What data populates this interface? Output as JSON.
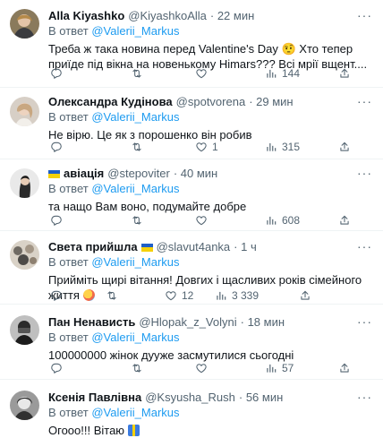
{
  "reply_prefix": "В ответ",
  "mention": "@Valerii_Markus",
  "tweets": [
    {
      "name": "Alla Kiyashko",
      "handle": "@KiyashkoAlla",
      "time": "· 22 мин",
      "text": "Треба ж така новина перед Valentine's Day 🤨 Хто тепер приїде під вікна на новенькому Himars??? Всі мрії вщент....",
      "replies": "",
      "retweets": "",
      "likes": "",
      "views": "144"
    },
    {
      "name": "Олександра Кудінова",
      "handle": "@spotvorena",
      "time": "· 29 мин",
      "text": "Не вірю. Це як з порошенко він робив",
      "replies": "",
      "retweets": "",
      "likes": "1",
      "views": "315"
    },
    {
      "name": "авіація",
      "handle": "@stepoviter",
      "time": "· 40 мин",
      "text": "та нащо Вам воно, подумайте добре",
      "replies": "",
      "retweets": "",
      "likes": "",
      "views": "608"
    },
    {
      "name": "Света прийшла",
      "handle": "@slavut4anka",
      "time": "· 1 ч",
      "text": "Прийміть щирі вітання! Довгих і щасливих років сімейного життя",
      "replies": "",
      "retweets": "",
      "likes": "12",
      "views": "3 339"
    },
    {
      "name": "Пан Ненависть",
      "handle": "@Hlopak_z_Volyni",
      "time": "· 18 мин",
      "text": "100000000 жінок дууже засмутилися сьогодні",
      "replies": "",
      "retweets": "",
      "likes": "",
      "views": "57"
    },
    {
      "name": "Ксенія Павлівна",
      "handle": "@Ksyusha_Rush",
      "time": "· 56 мин",
      "text": "Огоoo!!! Вітаю",
      "replies": "",
      "retweets": "",
      "likes": "",
      "views": ""
    }
  ],
  "colors": {
    "link": "#1d9bf0",
    "secondary": "#536471",
    "divider": "#eff3f4",
    "flag_blue": "#1f5fc7",
    "flag_yellow": "#f5d10a"
  },
  "icons": [
    "more-icon",
    "reply-icon",
    "retweet-icon",
    "like-icon",
    "views-icon",
    "share-icon",
    "ukraine-flag-icon"
  ]
}
